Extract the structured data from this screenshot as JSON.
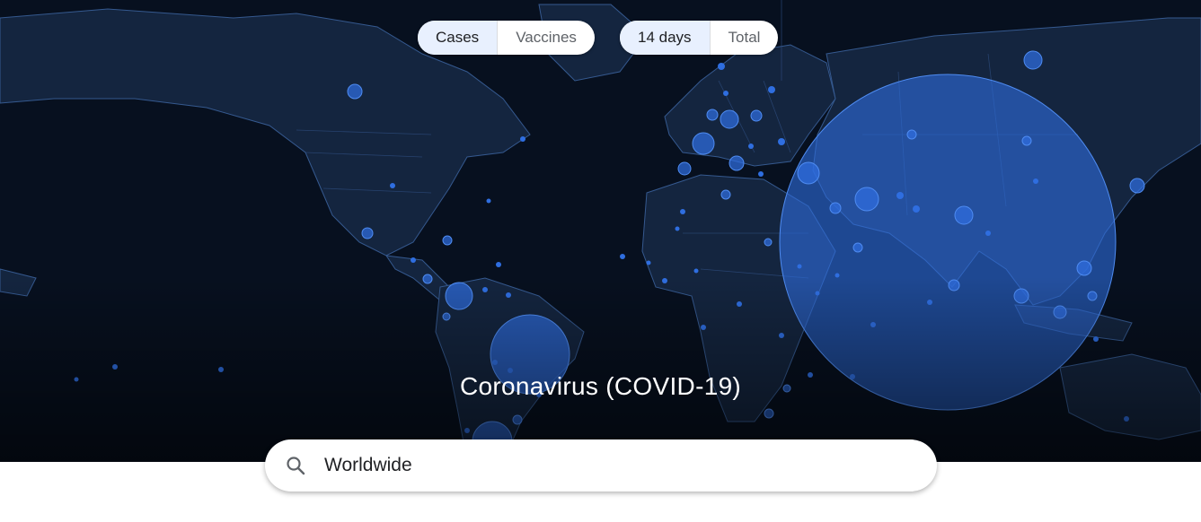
{
  "metric_tabs": [
    {
      "label": "Cases",
      "active": true
    },
    {
      "label": "Vaccines",
      "active": false
    }
  ],
  "range_tabs": [
    {
      "label": "14 days",
      "active": true
    },
    {
      "label": "Total",
      "active": false
    }
  ],
  "title": "Coronavirus (COVID-19)",
  "search": {
    "value": "Worldwide",
    "icon": "search-icon"
  },
  "colors": {
    "ocean": "#0a1628",
    "land": "#17294a",
    "borders": "#3a5a8c",
    "bubble": "#2f6ee0",
    "bubble_stroke": "#4f8cf2",
    "active_tab": "#e8f0fe"
  }
}
